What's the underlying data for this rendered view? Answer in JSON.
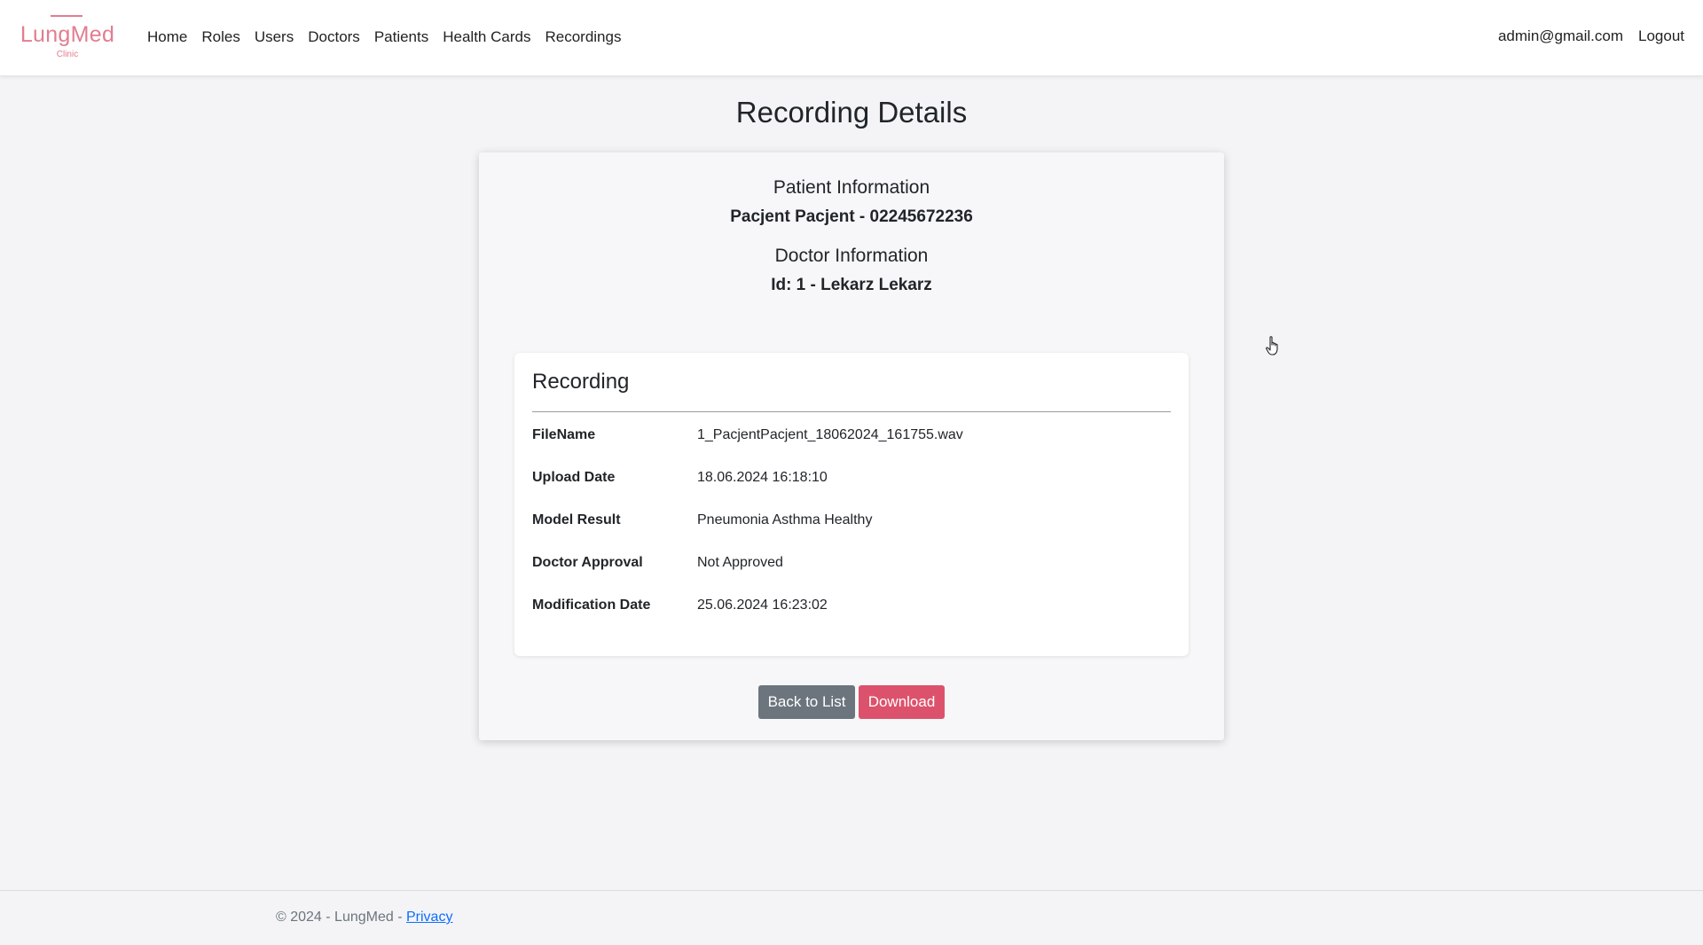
{
  "brand": {
    "name": "LungMed",
    "subtitle": "Clinic",
    "color": "#e27d8f"
  },
  "nav": {
    "items": [
      "Home",
      "Roles",
      "Users",
      "Doctors",
      "Patients",
      "Health Cards",
      "Recordings"
    ],
    "user_email": "admin@gmail.com",
    "logout": "Logout"
  },
  "page": {
    "title": "Recording Details"
  },
  "patient": {
    "heading": "Patient Information",
    "value": "Pacjent Pacjent - 02245672236"
  },
  "doctor": {
    "heading": "Doctor Information",
    "value": "Id: 1 - Lekarz Lekarz"
  },
  "recording": {
    "title": "Recording",
    "fields": [
      {
        "label": "FileName",
        "value": "1_PacjentPacjent_18062024_161755.wav"
      },
      {
        "label": "Upload Date",
        "value": "18.06.2024 16:18:10"
      },
      {
        "label": "Model Result",
        "value": "Pneumonia Asthma Healthy"
      },
      {
        "label": "Doctor Approval",
        "value": "Not Approved"
      },
      {
        "label": "Modification Date",
        "value": "25.06.2024 16:23:02"
      }
    ]
  },
  "actions": {
    "back": "Back to List",
    "download": "Download"
  },
  "footer": {
    "text": "© 2024 - LungMed - ",
    "privacy": "Privacy"
  },
  "colors": {
    "accent": "#dc526c",
    "secondary": "#6c757d",
    "link": "#0d6efd"
  },
  "icons": {
    "cursor": "hand-pointer-icon"
  }
}
